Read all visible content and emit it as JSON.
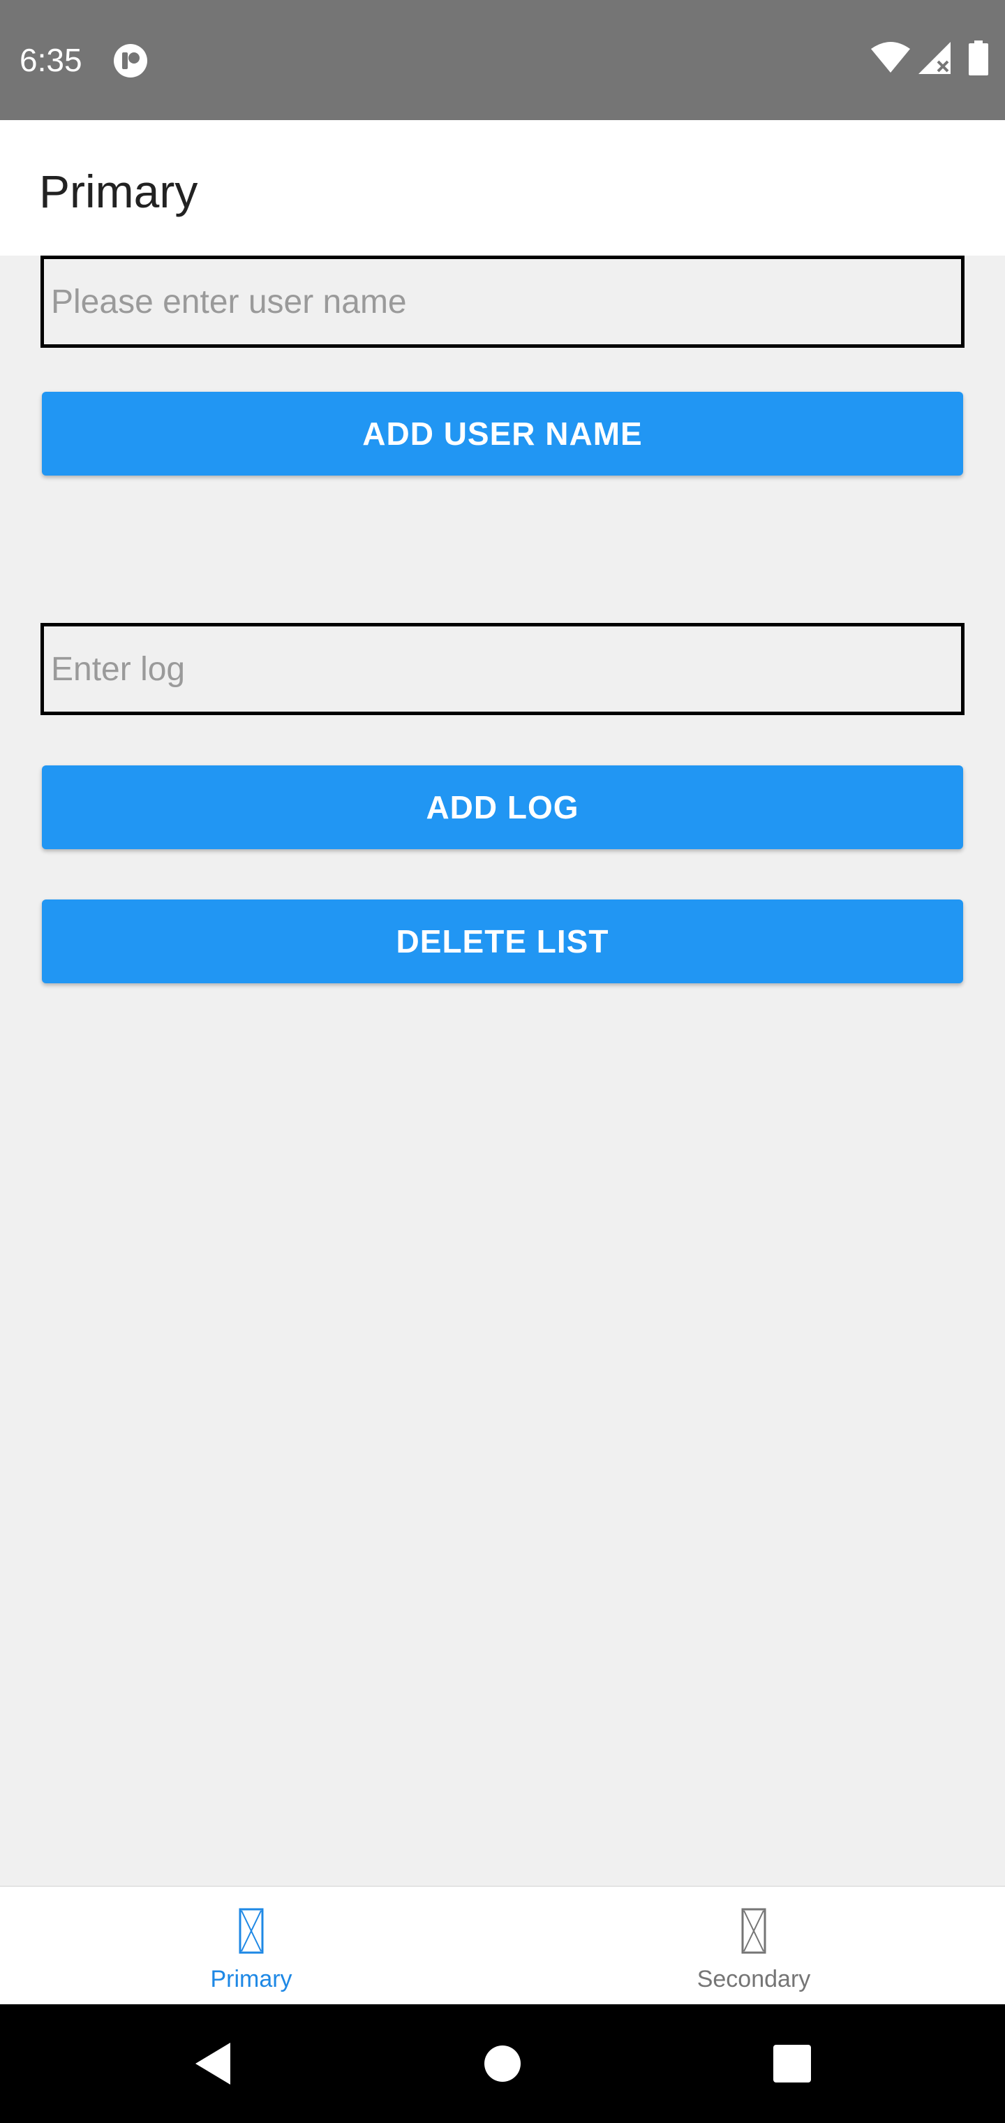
{
  "status_bar": {
    "time": "6:35",
    "app_icon": "circle-app-icon",
    "icons": [
      "wifi-icon",
      "cell-signal-icon",
      "battery-icon"
    ]
  },
  "app_bar": {
    "title": "Primary"
  },
  "form": {
    "username_placeholder": "Please enter user name",
    "username_value": "",
    "add_user_label": "ADD USER NAME",
    "log_placeholder": "Enter log",
    "log_value": "",
    "add_log_label": "ADD LOG",
    "delete_list_label": "DELETE LIST"
  },
  "bottom_nav": {
    "items": [
      {
        "label": "Primary",
        "icon": "placeholder-icon",
        "active": true
      },
      {
        "label": "Secondary",
        "icon": "placeholder-icon",
        "active": false
      }
    ]
  },
  "system_nav": {
    "icons": [
      "back-icon",
      "home-icon",
      "recents-icon"
    ]
  },
  "colors": {
    "accent": "#2196f3",
    "status_bar": "#757575",
    "active_tab": "#1e88e5",
    "inactive_tab": "#757575",
    "background": "#f0f0f0"
  }
}
